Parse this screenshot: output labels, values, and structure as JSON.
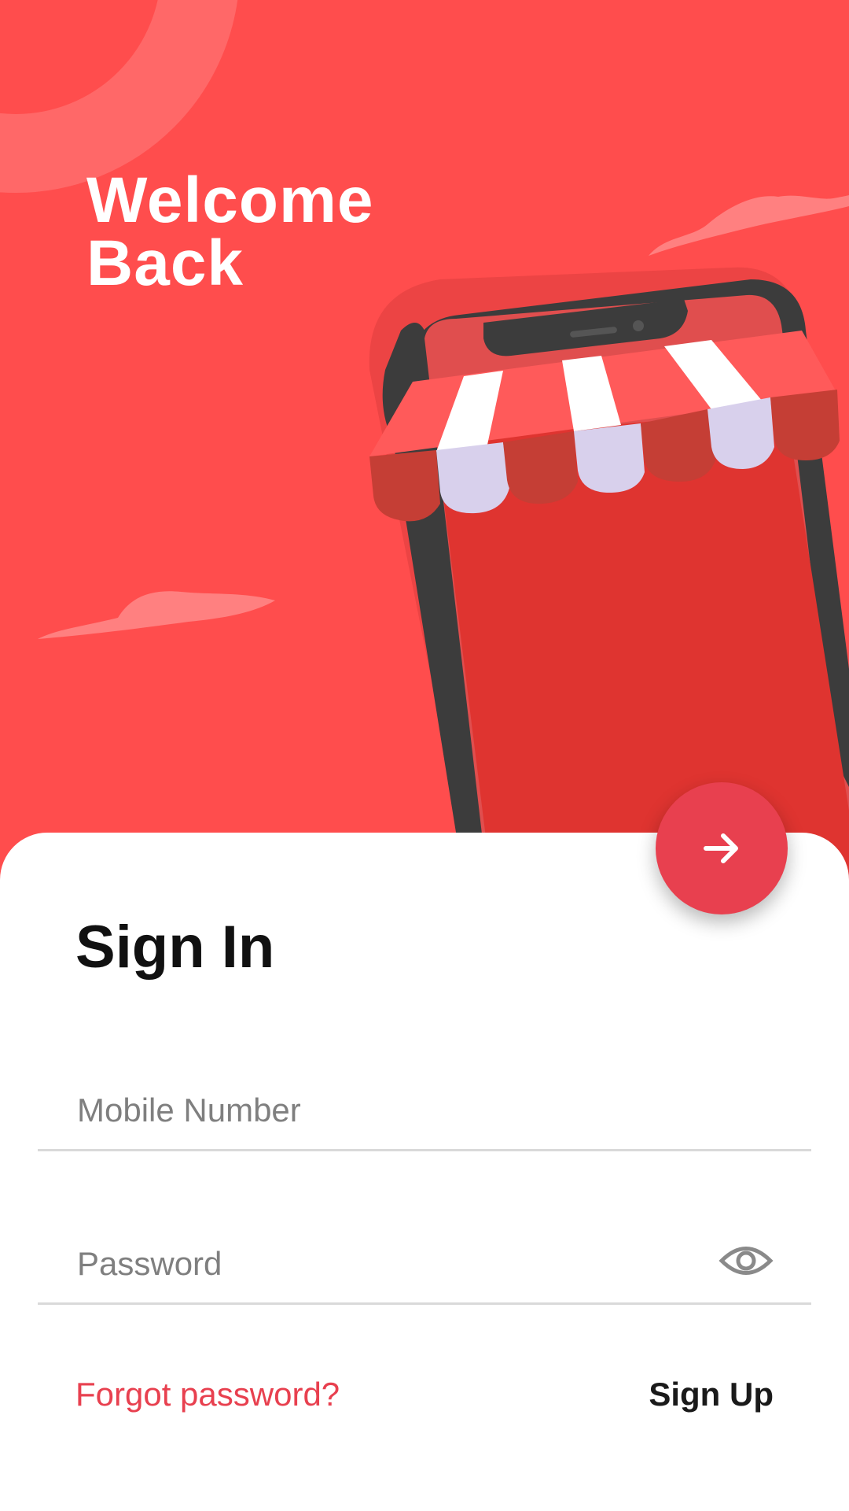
{
  "hero": {
    "title_line1": "Welcome",
    "title_line2": "Back",
    "background_color": "#ff4d4d",
    "illustration_icon": "storefront-phone-icon"
  },
  "fab": {
    "icon": "arrow-right-icon",
    "color": "#e8404f"
  },
  "form": {
    "title": "Sign In",
    "mobile": {
      "placeholder": "Mobile Number",
      "value": ""
    },
    "password": {
      "placeholder": "Password",
      "value": "",
      "toggle_icon": "eye-icon"
    }
  },
  "links": {
    "forgot": "Forgot password?",
    "signup": "Sign Up"
  },
  "colors": {
    "accent": "#e8404f",
    "divider": "#d9d9d9"
  }
}
